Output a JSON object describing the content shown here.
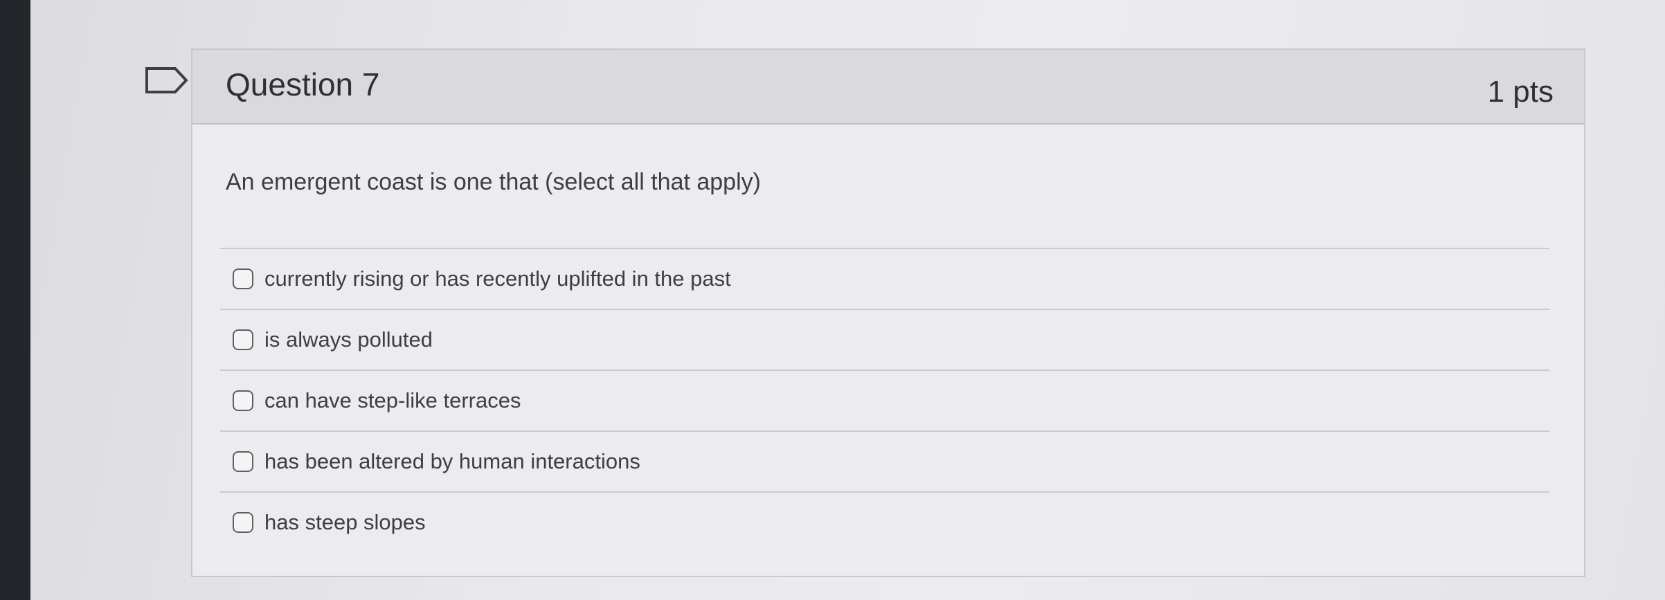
{
  "question": {
    "title": "Question 7",
    "points": "1 pts",
    "text": "An emergent coast is one that (select all that apply)",
    "flag_icon": "flag-bookmark-icon"
  },
  "answers": [
    {
      "label": "currently rising or has recently uplifted in the past",
      "checked": false
    },
    {
      "label": "is always polluted",
      "checked": false
    },
    {
      "label": "can have step-like terraces",
      "checked": false
    },
    {
      "label": "has been altered by human interactions",
      "checked": false
    },
    {
      "label": "has steep slopes",
      "checked": false
    }
  ],
  "colors": {
    "header_bg": "#dadadd",
    "body_bg": "#ececee",
    "border": "#c7c8cb",
    "text": "#3b3f45"
  }
}
